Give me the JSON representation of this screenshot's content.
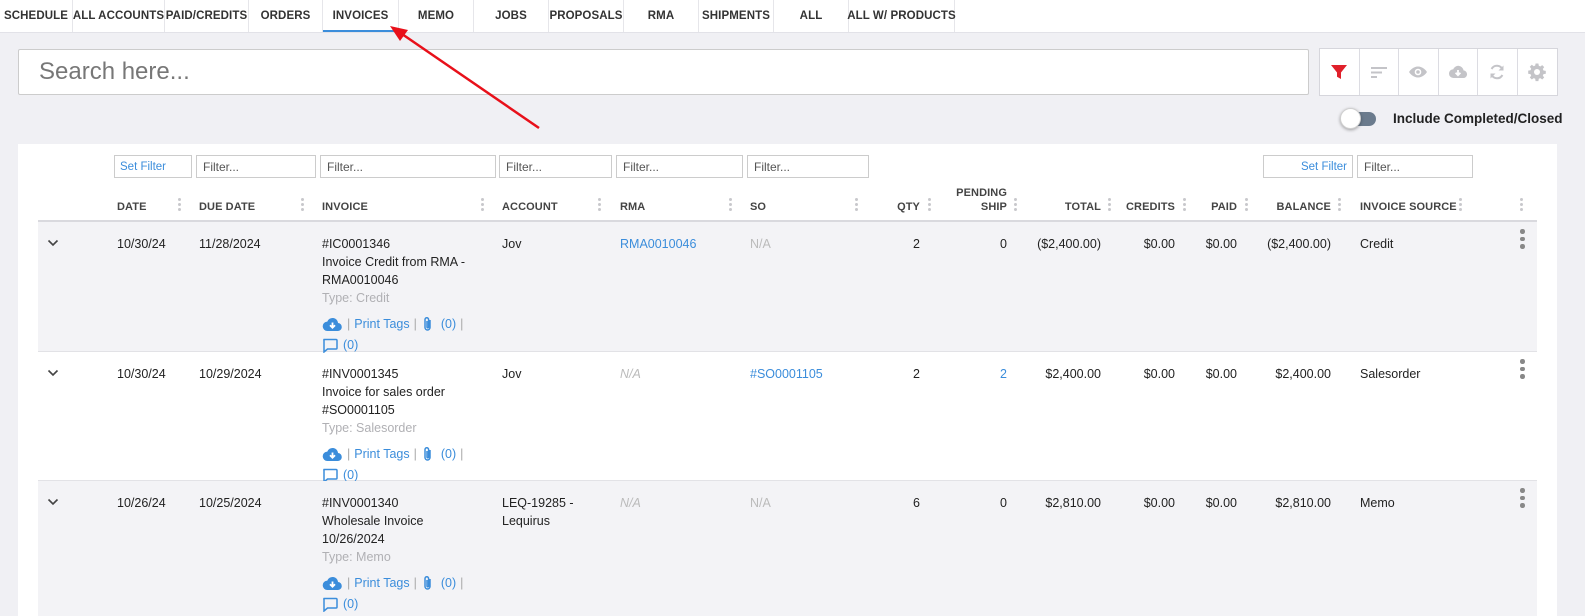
{
  "tabs": [
    {
      "label": "SCHEDULE",
      "w": 73
    },
    {
      "label": "ALL ACCOUNTS",
      "w": 92
    },
    {
      "label": "PAID/CREDITS",
      "w": 84
    },
    {
      "label": "ORDERS",
      "w": 74
    },
    {
      "label": "INVOICES",
      "w": 76,
      "active": true
    },
    {
      "label": "MEMO",
      "w": 75
    },
    {
      "label": "JOBS",
      "w": 75
    },
    {
      "label": "PROPOSALS",
      "w": 75
    },
    {
      "label": "RMA",
      "w": 75
    },
    {
      "label": "SHIPMENTS",
      "w": 75
    },
    {
      "label": "ALL",
      "w": 75
    },
    {
      "label": "ALL W/ PRODUCTS",
      "w": 106
    }
  ],
  "search": {
    "placeholder": "Search here..."
  },
  "toolbar": {
    "icons": [
      "filter-icon",
      "sort-icon",
      "eye-icon",
      "cloud-download-icon",
      "refresh-icon",
      "gear-icon"
    ],
    "filter_color": "#e0202a",
    "icon_color": "#c4c4c8"
  },
  "toggle": {
    "label": "Include Completed/Closed",
    "on": false
  },
  "filters": {
    "set_filter": "Set Filter",
    "placeholder": "Filter..."
  },
  "columns": {
    "date": "DATE",
    "due_date": "DUE DATE",
    "invoice": "INVOICE",
    "account": "ACCOUNT",
    "rma": "RMA",
    "so": "SO",
    "qty": "QTY",
    "pending_ship_1": "PENDING",
    "pending_ship_2": "SHIP",
    "total": "TOTAL",
    "credits": "CREDITS",
    "paid": "PAID",
    "balance": "BALANCE",
    "invoice_source": "INVOICE SOURCE"
  },
  "actions": {
    "print_tags": "Print Tags",
    "sep": "|"
  },
  "rows": [
    {
      "date": "10/30/24",
      "due_date": "11/28/2024",
      "invoice_no": "#IC0001346",
      "invoice_desc_1": "Invoice Credit from RMA -",
      "invoice_desc_2": "RMA0010046",
      "type": "Type: Credit",
      "attachments": "(0)",
      "comments": "(0)",
      "account_1": "Jov",
      "account_2": "",
      "rma": "RMA0010046",
      "rma_style": "link",
      "so": "N/A",
      "so_style": "na2",
      "qty": "2",
      "pending_ship": "0",
      "pending_style": "plain",
      "total": "($2,400.00)",
      "credits": "$0.00",
      "paid": "$0.00",
      "balance": "($2,400.00)",
      "source": "Credit"
    },
    {
      "date": "10/30/24",
      "due_date": "10/29/2024",
      "invoice_no": "#INV0001345",
      "invoice_desc_1": "Invoice for sales order",
      "invoice_desc_2": "#SO0001105",
      "type": "Type: Salesorder",
      "attachments": "(0)",
      "comments": "(0)",
      "account_1": "Jov",
      "account_2": "",
      "rma": "N/A",
      "rma_style": "na",
      "so": "#SO0001105",
      "so_style": "link",
      "qty": "2",
      "pending_ship": "2",
      "pending_style": "link",
      "total": "$2,400.00",
      "credits": "$0.00",
      "paid": "$0.00",
      "balance": "$2,400.00",
      "source": "Salesorder"
    },
    {
      "date": "10/26/24",
      "due_date": "10/25/2024",
      "invoice_no": "#INV0001340",
      "invoice_desc_1": "Wholesale Invoice",
      "invoice_desc_2": "10/26/2024",
      "type": "Type: Memo",
      "attachments": "(0)",
      "comments": "(0)",
      "account_1": "LEQ-19285 -",
      "account_2": "Lequirus",
      "rma": "N/A",
      "rma_style": "na",
      "so": "N/A",
      "so_style": "na2",
      "qty": "6",
      "pending_ship": "0",
      "pending_style": "plain",
      "total": "$2,810.00",
      "credits": "$0.00",
      "paid": "$0.00",
      "balance": "$2,810.00",
      "source": "Memo"
    }
  ],
  "colors": {
    "accent": "#3b8ddb",
    "arrow": "#e8101a",
    "filter_active": "#e0202a"
  }
}
